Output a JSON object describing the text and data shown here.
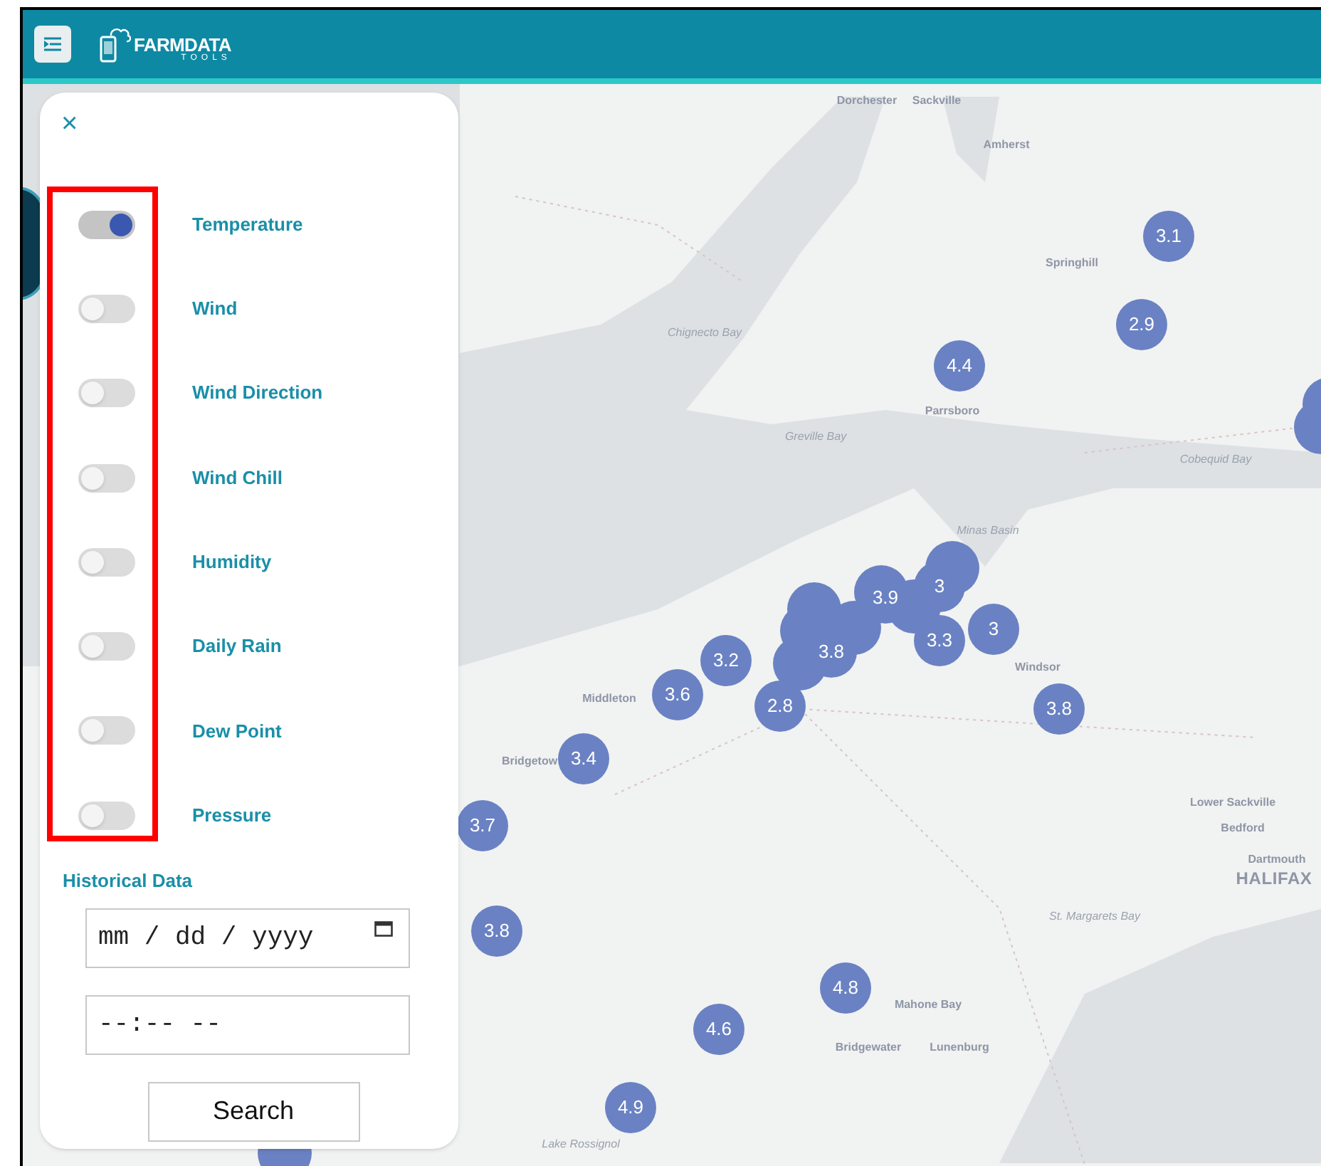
{
  "header": {
    "logo": {
      "title": "FARMDATA",
      "subtitle": "TOOLS"
    }
  },
  "panel": {
    "close": "×",
    "layers": [
      {
        "label": "Temperature",
        "on": true
      },
      {
        "label": "Wind",
        "on": false
      },
      {
        "label": "Wind Direction",
        "on": false
      },
      {
        "label": "Wind Chill",
        "on": false
      },
      {
        "label": "Humidity",
        "on": false
      },
      {
        "label": "Daily Rain",
        "on": false
      },
      {
        "label": "Dew Point",
        "on": false
      },
      {
        "label": "Pressure",
        "on": false
      }
    ],
    "historical": {
      "title": "Historical Data",
      "date": {
        "placeholder": "mm / dd / yyyy"
      },
      "time": {
        "placeholder": "--:-- --"
      },
      "button": "Search"
    }
  },
  "map": {
    "places": [
      {
        "name": "Dorchester",
        "kind": "town"
      },
      {
        "name": "Sackville",
        "kind": "town"
      },
      {
        "name": "Amherst",
        "kind": "town"
      },
      {
        "name": "Springhill",
        "kind": "town"
      },
      {
        "name": "Chignecto Bay",
        "kind": "water"
      },
      {
        "name": "Parrsboro",
        "kind": "town"
      },
      {
        "name": "Greville Bay",
        "kind": "water"
      },
      {
        "name": "Cobequid Bay",
        "kind": "water"
      },
      {
        "name": "Minas Basin",
        "kind": "water"
      },
      {
        "name": "Windsor",
        "kind": "town"
      },
      {
        "name": "Middleton",
        "kind": "town"
      },
      {
        "name": "Bridgetow",
        "kind": "town"
      },
      {
        "name": "Lower Sackville",
        "kind": "town"
      },
      {
        "name": "Bedford",
        "kind": "town"
      },
      {
        "name": "Dartmouth",
        "kind": "town"
      },
      {
        "name": "HALIFAX",
        "kind": "city"
      },
      {
        "name": "St. Margarets Bay",
        "kind": "water"
      },
      {
        "name": "Mahone Bay",
        "kind": "town"
      },
      {
        "name": "Bridgewater",
        "kind": "town"
      },
      {
        "name": "Lunenburg",
        "kind": "town"
      },
      {
        "name": "Lake Rossignol",
        "kind": "water"
      }
    ],
    "markers": [
      {
        "label": "3.1"
      },
      {
        "label": "2.9"
      },
      {
        "label": "4.4"
      },
      {
        "label": "3.9"
      },
      {
        "label": "3"
      },
      {
        "label": "3"
      },
      {
        "label": "3.3"
      },
      {
        "label": "3.8"
      },
      {
        "label": "3.2"
      },
      {
        "label": "3.6"
      },
      {
        "label": "2.8"
      },
      {
        "label": "3.8"
      },
      {
        "label": "3.4"
      },
      {
        "label": "3.7"
      },
      {
        "label": "3.8"
      },
      {
        "label": "4.8"
      },
      {
        "label": "4.6"
      },
      {
        "label": "4.9"
      }
    ]
  }
}
